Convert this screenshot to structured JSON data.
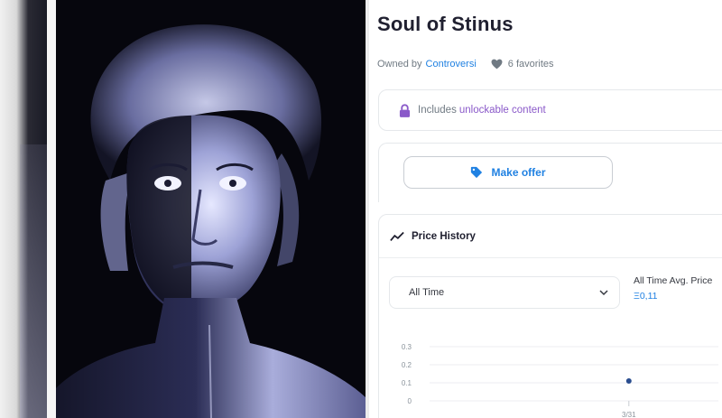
{
  "asset": {
    "title": "Soul of Stinus",
    "owned_by_label": "Owned by",
    "owner_name": "Controversi",
    "favorites": "6 favorites"
  },
  "unlockable": {
    "prefix": "Includes",
    "link": "unlockable content"
  },
  "offer": {
    "button_label": "Make offer"
  },
  "price_history": {
    "title": "Price History",
    "range_select_value": "All Time",
    "avg_label": "All Time Avg. Price",
    "avg_value": "Ξ0,11"
  },
  "chart_data": {
    "type": "scatter",
    "ylim": [
      0,
      0.3
    ],
    "y_ticks": [
      "0.3",
      "0.2",
      "0.1",
      "0"
    ],
    "x_ticks": [
      "3/31"
    ],
    "points": [
      {
        "x": "3/31",
        "y": 0.11
      }
    ]
  },
  "colors": {
    "accent": "#2081e2",
    "unlock": "#8a59c9",
    "muted": "#707a83"
  }
}
